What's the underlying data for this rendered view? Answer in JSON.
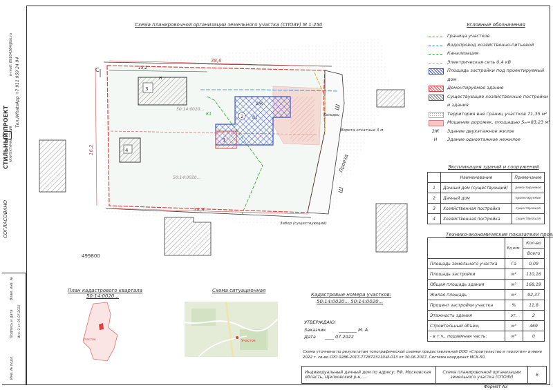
{
  "sheet": {
    "main_title": "Схема планировочной организации земельного участка (СПОЗУ) М 1:250",
    "number_label": "499800",
    "format": "Формат А3",
    "page": "6"
  },
  "company": {
    "name": "СТИЛЬНЫЙ ПРОЕКТ",
    "subtitle": "АРХИТЕКТУРНАЯ СТУДИЯ",
    "phone": "Тел./WhatsApp +7 911 959 24 94",
    "email": "e-mail: 89104364@bk.ru"
  },
  "margin": {
    "agreed": "СОГЛАСОВАНО",
    "inv_podl": "Инв. № подл.",
    "podpis_data": "Подпись и дата",
    "vzam_inv": "Взам. инв. №",
    "ispolnil": "Исп. 1 от 05.07.2022"
  },
  "legend": {
    "title": "Условные обозначения",
    "items": [
      {
        "label": "Граница участков",
        "swatch": "boundary"
      },
      {
        "label": "Водопровод хозяйственно-питьевой",
        "swatch": "water"
      },
      {
        "label": "Канализация",
        "swatch": "sewer"
      },
      {
        "label": "Электрическая сеть 0,4 кВ",
        "swatch": "power"
      },
      {
        "label": "Площадь застройки под проектируемый",
        "swatch": "blue"
      },
      {
        "label": "дом",
        "swatch": "none"
      },
      {
        "label": "Демонтируемое здание",
        "swatch": "red"
      },
      {
        "label": "Существующие хозяйственные постройки",
        "swatch": "gray"
      },
      {
        "label": "и здания",
        "swatch": "none"
      },
      {
        "label": "Территория вне границ участков 71,35 м²",
        "swatch": "dots"
      },
      {
        "label": "Мощение дорожек, площадью Sₘ=83,23 м²",
        "swatch": "paving"
      },
      {
        "label": "Здание двухэтажное жилое",
        "swatch": "2Ж"
      },
      {
        "label": "Здание одноэтажное нежилое",
        "swatch": "Н"
      }
    ]
  },
  "explication": {
    "title": "Экспликация зданий и сооружений",
    "headers": [
      "Наименование",
      "Примечание"
    ],
    "rows": [
      {
        "n": "1",
        "name": "Дачный дом (существующий)",
        "note": "демонтируемое"
      },
      {
        "n": "2",
        "name": "Дачный дом",
        "note": "проектируемое"
      },
      {
        "n": "3",
        "name": "Хозяйственная постройка",
        "note": "существующая"
      },
      {
        "n": "4",
        "name": "Хозяйственная постройка",
        "note": "существующая"
      }
    ]
  },
  "tep": {
    "title": "Технико-экономические показатели проекта",
    "headers": [
      "Ед.изм.",
      "Кол-во",
      "Всего"
    ],
    "rows": [
      {
        "name": "Площадь земельного участка",
        "unit": "Га",
        "value": "0,09"
      },
      {
        "name": "Площадь застройки",
        "unit": "м²",
        "value": "110,16"
      },
      {
        "name": "Общая площадь здания",
        "unit": "м²",
        "value": "168,19"
      },
      {
        "name": "Жилая площадь",
        "unit": "м²",
        "value": "92,37"
      },
      {
        "name": "Процент застройки участка",
        "unit": "%",
        "value": "11,8"
      },
      {
        "name": "Этажность здания",
        "unit": "эт.",
        "value": "2"
      },
      {
        "name": "Строительный объем,",
        "unit": "м³",
        "value": "469"
      },
      {
        "name": "- в т.ч., подземная часть:",
        "unit": "м³",
        "value": "0"
      }
    ]
  },
  "plan_labels": {
    "dim_top": "38,6",
    "dim_bottom": "38,9",
    "dim_left": "16,2",
    "dim_inner": "15,2",
    "north": "С",
    "gate": "Ворота откатные 3 м",
    "proezd": "Проезд",
    "zabor": "Забор (существующий)",
    "b1": "В1",
    "k1": "К1",
    "lot_num": "50:14:0020...",
    "b1_cap": "Колодец",
    "v_lot": "Ввод в здание"
  },
  "bottom": {
    "cadastral_title": "План кадастрового квартала",
    "cadastral_num": "50:14:0020...",
    "situation_title": "Схема ситуационная",
    "numbers_title": "Кадастровые номера участков:",
    "numbers_value": "50:14:0020... 50:14:0020...",
    "approved": "УТВЕРЖДАЮ:",
    "customer_label": "Заказчик",
    "customer_value": "________ М. А.",
    "date_label": "Дата",
    "date_value": "____ 07.2022",
    "note": "Схема уточнена по результатам топографической съемки предоставленной ООО «Строительство и геология» в июне 2022 г. св-во СРО 0286-2017-7728723110-И-013 от 30.06.2017. Система координат МСК-50.",
    "stamp_left": "Индивидуальный дачный дом по адресу: РФ, Московская область, Щелковский р-н, ...",
    "stamp_right": "Схема планировочной организации земельного участка (СПОЗУ)",
    "map_label": "Участок",
    "cad_label": "Участок"
  }
}
